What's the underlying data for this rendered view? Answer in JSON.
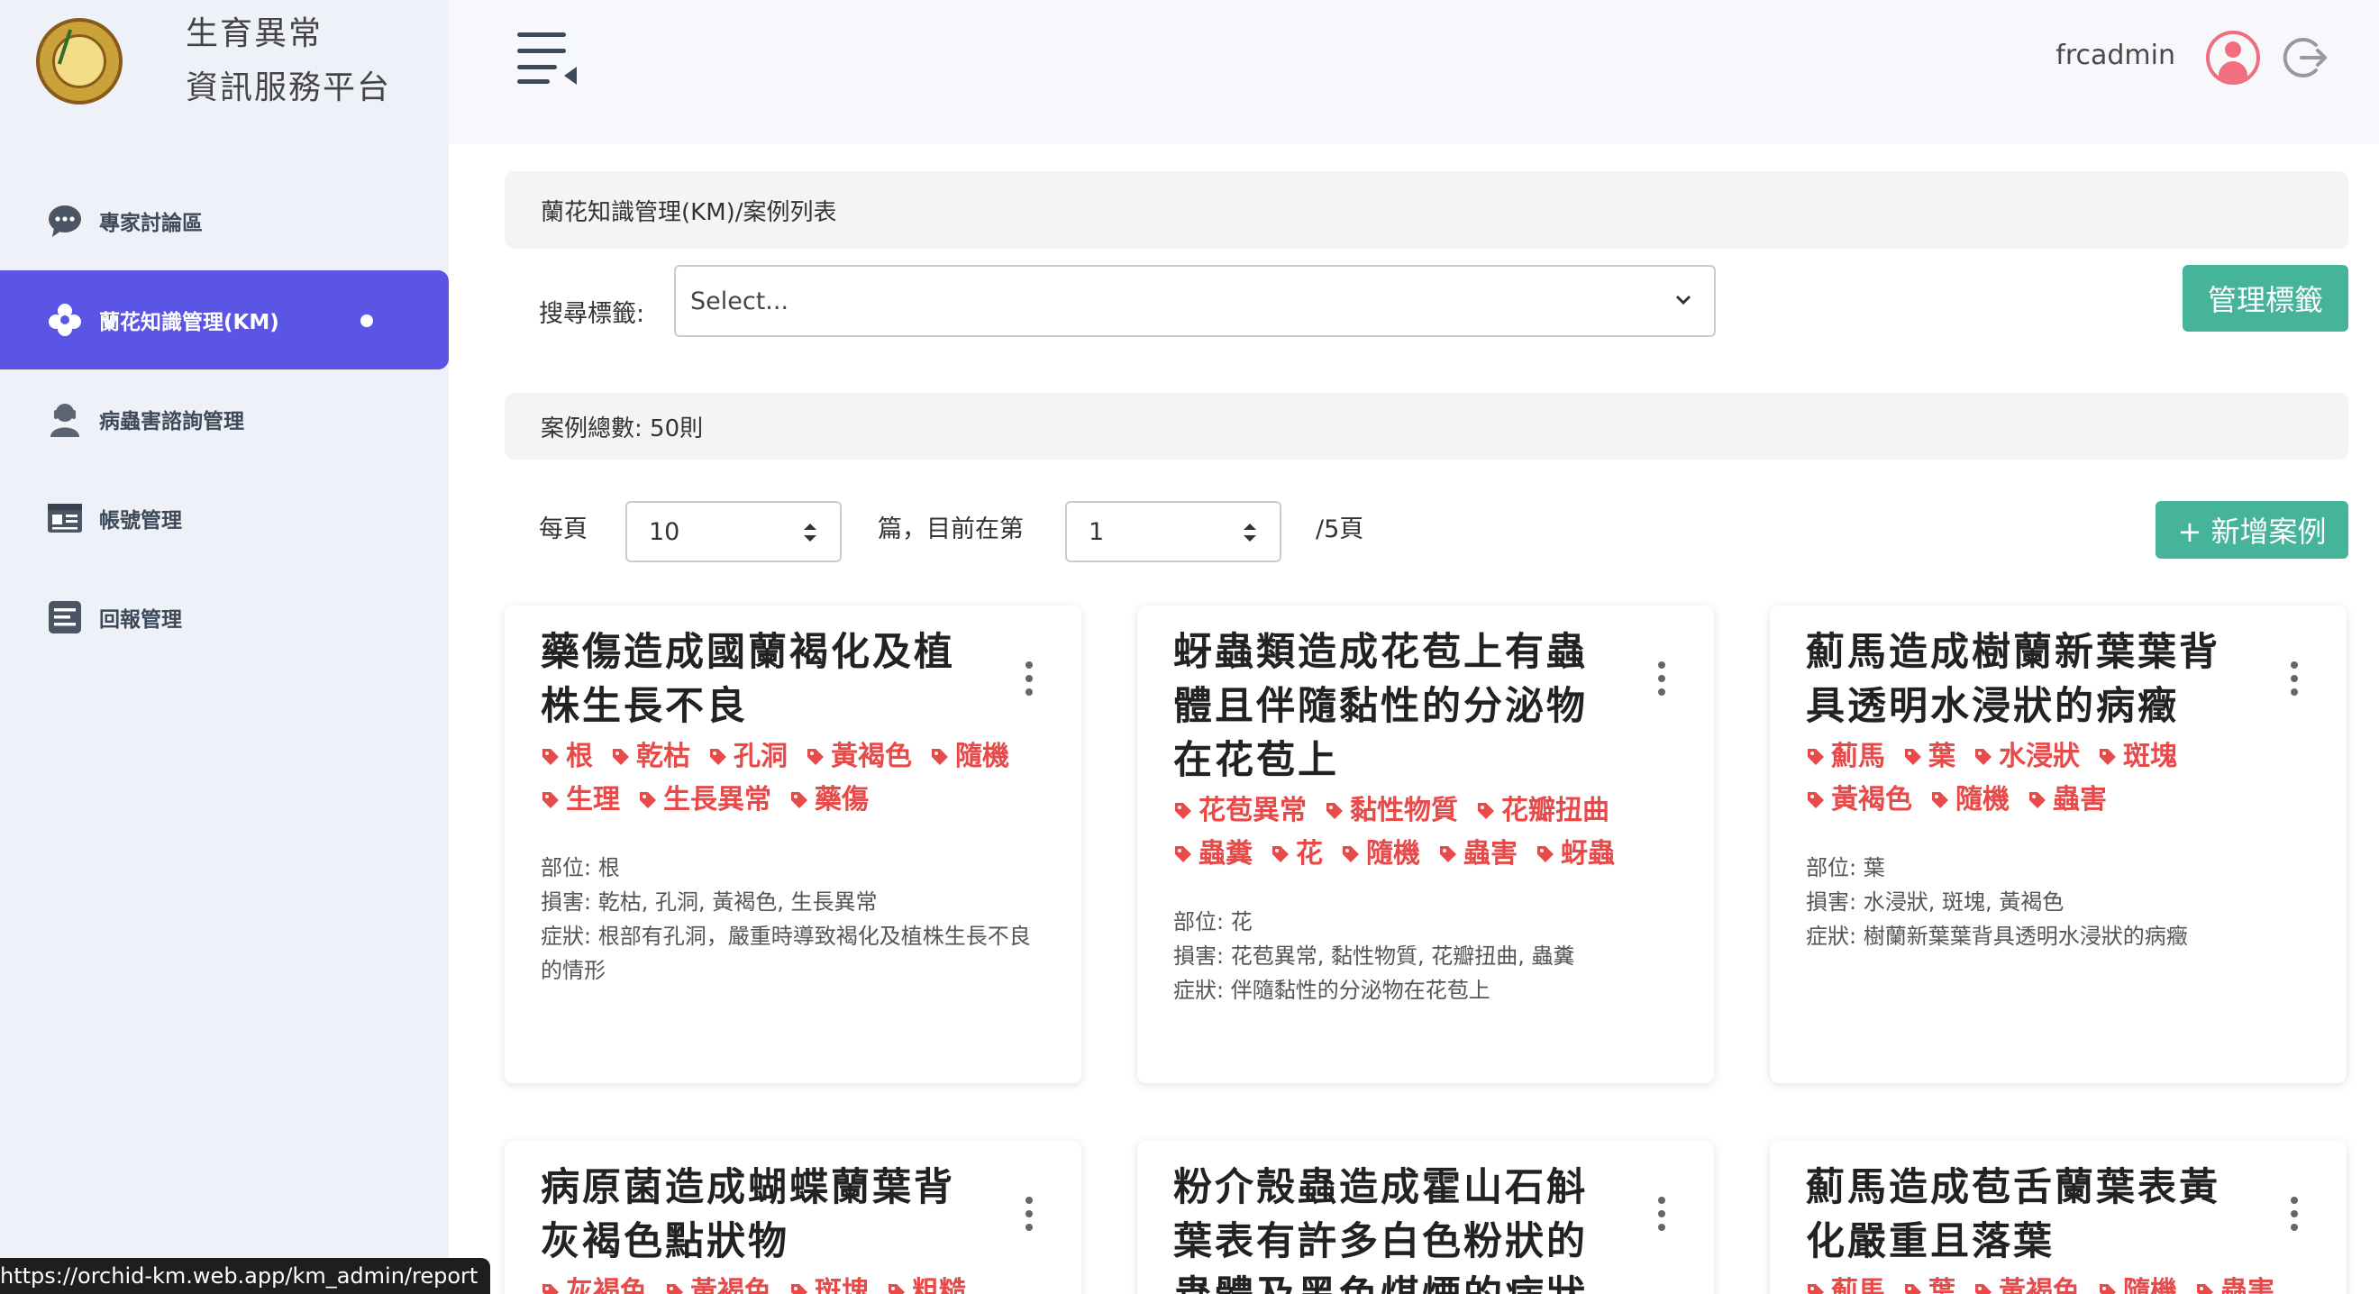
{
  "brand": {
    "line1": "生育異常",
    "line2": "資訊服務平台"
  },
  "sidebar": {
    "items": [
      {
        "label": "專家討論區",
        "icon": "chat-bubble-icon"
      },
      {
        "label": "蘭花知識管理(KM)",
        "icon": "orchid-icon",
        "active": true
      },
      {
        "label": "病蟲害諮詢管理",
        "icon": "user-support-icon"
      },
      {
        "label": "帳號管理",
        "icon": "id-card-icon"
      },
      {
        "label": "回報管理",
        "icon": "report-list-icon"
      }
    ]
  },
  "header": {
    "username": "frcadmin"
  },
  "breadcrumb": "蘭花知識管理(KM)/案例列表",
  "search": {
    "label": "搜尋標籤:",
    "placeholder": "Select..."
  },
  "buttons": {
    "manage_tags": "管理標籤",
    "add_case": "+ 新增案例"
  },
  "summary": {
    "total": "案例總數: 50則"
  },
  "pagination": {
    "per_page_label": "每頁",
    "per_page_value": "10",
    "middle_label": "篇，目前在第",
    "current_page": "1",
    "total_label": "/5頁"
  },
  "cards": [
    {
      "title": "藥傷造成國蘭褐化及植株生長不良",
      "tags": [
        "根",
        "乾枯",
        "孔洞",
        "黃褐色",
        "隨機",
        "生理",
        "生長異常",
        "藥傷"
      ],
      "part": "部位: 根",
      "damage": "損害: 乾枯, 孔洞, 黃褐色, 生長異常",
      "symptom": "症狀: 根部有孔洞，嚴重時導致褐化及植株生長不良的情形"
    },
    {
      "title": "蚜蟲類造成花苞上有蟲體且伴隨黏性的分泌物在花苞上",
      "tags": [
        "花苞異常",
        "黏性物質",
        "花瓣扭曲",
        "蟲糞",
        "花",
        "隨機",
        "蟲害",
        "蚜蟲"
      ],
      "part": "部位: 花",
      "damage": "損害: 花苞異常, 黏性物質, 花瓣扭曲, 蟲糞",
      "symptom": "症狀: 伴隨黏性的分泌物在花苞上"
    },
    {
      "title": "薊馬造成樹蘭新葉葉背具透明水浸狀的病癥",
      "tags": [
        "薊馬",
        "葉",
        "水浸狀",
        "斑塊",
        "黃褐色",
        "隨機",
        "蟲害"
      ],
      "part": "部位: 葉",
      "damage": "損害: 水浸狀, 斑塊, 黃褐色",
      "symptom": "症狀: 樹蘭新葉葉背具透明水浸狀的病癥"
    },
    {
      "title": "病原菌造成蝴蝶蘭葉背灰褐色點狀物",
      "tags": [
        "灰褐色",
        "黃褐色",
        "斑塊",
        "粗糙"
      ],
      "part": "",
      "damage": "",
      "symptom": ""
    },
    {
      "title": "粉介殼蟲造成霍山石斛葉表有許多白色粉狀的蟲體及黑色煤煙的病狀",
      "tags": [],
      "part": "",
      "damage": "",
      "symptom": ""
    },
    {
      "title": "薊馬造成苞舌蘭葉表黃化嚴重且落葉",
      "tags": [
        "薊馬",
        "葉",
        "黃褐色",
        "隨機",
        "蟲害"
      ],
      "part": "",
      "damage": "",
      "symptom": ""
    }
  ],
  "status_bar": {
    "url": "https://orchid-km.web.app/km_admin/report"
  },
  "colors": {
    "accent": "#5b55e6",
    "button": "#45b49a",
    "tag": "#e84a4a"
  }
}
